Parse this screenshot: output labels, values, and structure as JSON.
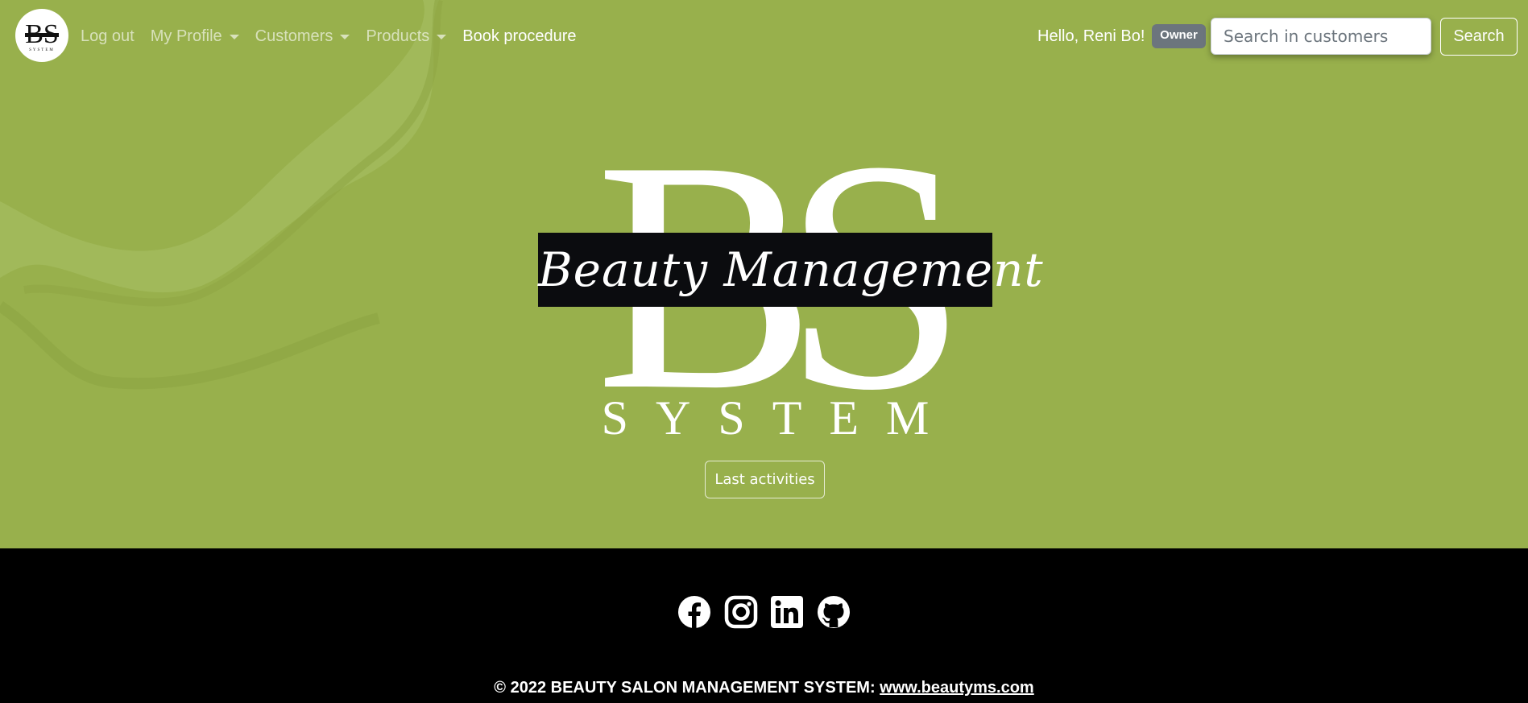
{
  "colors": {
    "hero_bg": "#98b04c",
    "footer_bg": "#000000",
    "badge_bg": "#6c757d"
  },
  "nav": {
    "logo_icon": "bs-logo-icon",
    "links": {
      "logout": "Log out",
      "profile": "My Profile",
      "customers": "Customers",
      "products": "Products",
      "book": "Book procedure"
    },
    "greeting": "Hello, Reni Bo!",
    "role_badge": "Owner",
    "search": {
      "placeholder": "Search in customers",
      "value": "",
      "button": "Search"
    }
  },
  "hero": {
    "monogram": "BS",
    "tagline": "Beauty Management",
    "system_word": "SYSTEM",
    "activities_button": "Last activities"
  },
  "footer": {
    "social_icons": [
      "facebook-icon",
      "instagram-icon",
      "linkedin-icon",
      "github-icon"
    ],
    "copyright_prefix": "© 2022 BEAUTY SALON MANAGEMENT SYSTEM: ",
    "link": "www.beautyms.com"
  }
}
